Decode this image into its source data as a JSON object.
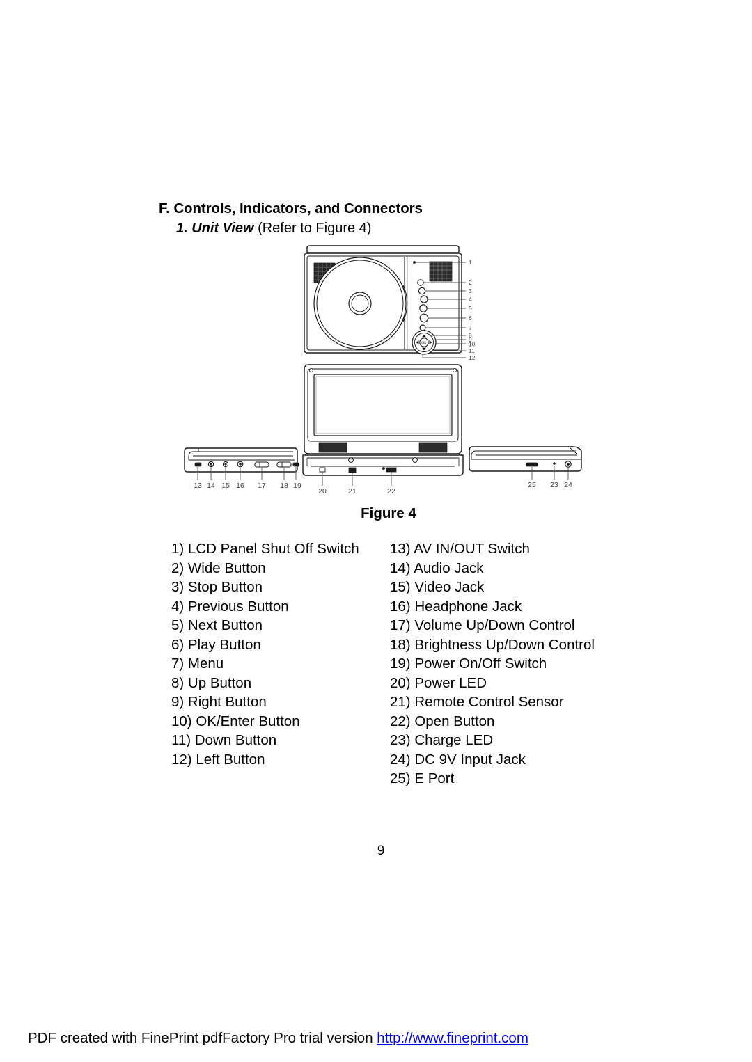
{
  "document": {
    "section_heading": "F. Controls, Indicators, and Connectors",
    "sub_heading_strong": "1. Unit View",
    "sub_heading_rest": " (Refer to Figure 4)",
    "figure_caption": "Figure 4",
    "page_number": "9"
  },
  "parts": {
    "left_column": [
      "1) LCD Panel Shut Off Switch",
      "2) Wide Button",
      "3) Stop Button",
      "4) Previous Button",
      "5) Next Button",
      "6) Play Button",
      "7) Menu",
      "8) Up Button",
      "9) Right Button",
      "10) OK/Enter Button",
      "11) Down Button",
      "12) Left Button"
    ],
    "right_column": [
      "13) AV IN/OUT Switch",
      "14) Audio  Jack",
      "15) Video Jack",
      "16) Headphone Jack",
      "17) Volume Up/Down Control",
      "18) Brightness Up/Down Control",
      "19) Power On/Off Switch",
      "20) Power LED",
      "21) Remote Control Sensor",
      "22) Open Button",
      "23) Charge LED",
      "24) DC 9V Input Jack",
      "25) E Port"
    ]
  },
  "figure": {
    "top_view_callouts": [
      "1",
      "2",
      "3",
      "4",
      "5",
      "6",
      "7",
      "8",
      "9",
      "10",
      "11",
      "12"
    ],
    "left_side_callouts": [
      "13",
      "14",
      "15",
      "16",
      "17",
      "18",
      "19"
    ],
    "front_callouts": [
      "20",
      "21",
      "22"
    ],
    "right_side_callouts": [
      "25",
      "23",
      "24"
    ],
    "dpad_center_label": "OK"
  },
  "footer": {
    "text": "PDF created with FinePrint pdfFactory Pro trial version ",
    "link": "http://www.fineprint.com"
  },
  "colors": {
    "text": "#000000",
    "link": "#0000ee",
    "background": "#ffffff",
    "diagram_stroke": "#1a1a1a",
    "speaker_fill": "#2b2b2b"
  }
}
